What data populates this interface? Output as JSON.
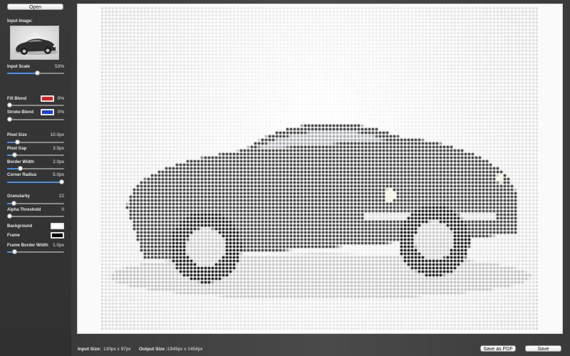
{
  "toolbar": {
    "open_label": "Open"
  },
  "input_image": {
    "label": "Input Image:"
  },
  "input_scale": {
    "label": "Input Scale",
    "value": "53%",
    "level": 0.53
  },
  "fill_blend": {
    "label": "Fill Blend",
    "value": "0%",
    "color": "#d61f1f",
    "level": 0.0
  },
  "stroke_blend": {
    "label": "Stroke Blend",
    "value": "0%",
    "color": "#1f3fd6",
    "level": 0.0
  },
  "pixel_size": {
    "label": "Pixel Size",
    "value": "10.0px",
    "level": 0.15
  },
  "pixel_gap": {
    "label": "Pixel Gap",
    "value": "3.0px",
    "level": 0.1
  },
  "border_width": {
    "label": "Border Width",
    "value": "2.0px",
    "level": 0.2
  },
  "corner_radius": {
    "label": "Corner Radius",
    "value": "5.0px",
    "level": 1.0
  },
  "granularity": {
    "label": "Granularity",
    "value": "22",
    "level": 0.08
  },
  "alpha_threshold": {
    "label": "Alpha Threshold",
    "value": "0",
    "level": 0.0
  },
  "background": {
    "label": "Background",
    "color": "#ffffff"
  },
  "frame": {
    "label": "Frame",
    "color": "#000000"
  },
  "frame_border_width": {
    "label": "Frame Border Width",
    "value": "1.0px",
    "level": 0.1
  },
  "footer": {
    "input_size_label": "Input Size:",
    "input_size_value": "130px x 97px",
    "output_size_label": "Output Size :",
    "output_size_value": "1949px x 1454px",
    "save_pdf_label": "Save as PDF",
    "save_label": "Save"
  }
}
